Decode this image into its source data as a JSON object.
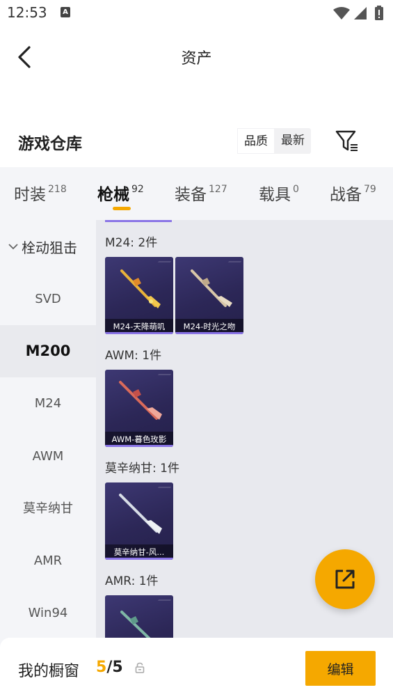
{
  "status_bar": {
    "time": "12:53",
    "notification_badge": "A"
  },
  "header": {
    "title": "资产",
    "back_icon": "chevron-left-icon"
  },
  "warehouse": {
    "title": "游戏仓库",
    "sort_options": [
      "品质",
      "最新"
    ],
    "sort_selected": "品质",
    "filter_icon": "filter-icon"
  },
  "tabs": [
    {
      "label": "时装",
      "count": "218"
    },
    {
      "label": "枪械",
      "count": "92"
    },
    {
      "label": "装备",
      "count": "127"
    },
    {
      "label": "载具",
      "count": "0"
    },
    {
      "label": "战备",
      "count": "79"
    }
  ],
  "active_tab": "枪械",
  "sidebar": {
    "group": "栓动狙击",
    "items": [
      "SVD",
      "M200",
      "M24",
      "AWM",
      "莫辛纳甘",
      "AMR",
      "Win94"
    ],
    "selected": "M200"
  },
  "content_groups": [
    {
      "title": "M24: 2件",
      "items": [
        "M24-天降萌叽",
        "M24-时光之吻"
      ]
    },
    {
      "title": "AWM: 1件",
      "items": [
        "AWM-暮色玫影"
      ]
    },
    {
      "title": "莫辛纳甘: 1件",
      "items": [
        "莫辛纳甘-风..."
      ]
    },
    {
      "title": "AMR: 1件",
      "items": [
        ""
      ]
    }
  ],
  "fab_icon": "share-icon",
  "bottom_bar": {
    "showcase_label": "我的橱窗",
    "showcase_current": "5",
    "showcase_separator": "/",
    "showcase_total": "5",
    "lock_icon": "lock-icon",
    "edit_label": "编辑"
  },
  "colors": {
    "accent": "#f5a800",
    "card_bg": "#2c2757",
    "card_bar": "#8a74e6"
  }
}
